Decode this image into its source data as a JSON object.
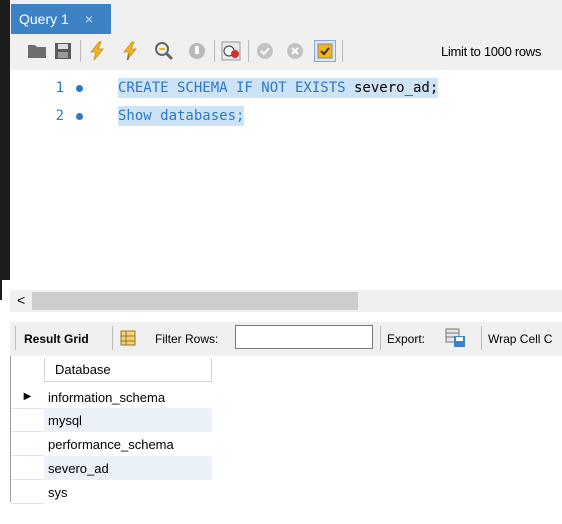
{
  "tab": {
    "label": "Query 1",
    "close": "×"
  },
  "toolbar": {
    "icons": [
      "open-folder-icon",
      "save-icon",
      "execute-icon",
      "execute-current-icon",
      "explain-icon",
      "stop-icon",
      "toggle-error-icon",
      "commit-icon",
      "rollback-icon",
      "autocommit-icon"
    ],
    "limit_label": "Limit to 1000 rows"
  },
  "editor": {
    "lines": [
      {
        "number": "1",
        "keywords": "CREATE SCHEMA IF NOT EXISTS",
        "rest": " severo_ad;"
      },
      {
        "number": "2",
        "keywords": "Show databases;",
        "rest": ""
      }
    ]
  },
  "scroll": {
    "left_arrow": "<"
  },
  "result_toolbar": {
    "result_grid": "Result Grid",
    "filter_rows": "Filter Rows:",
    "filter_value": "",
    "export": "Export:",
    "wrap": "Wrap Cell C"
  },
  "grid": {
    "header": "Database",
    "rows": [
      "information_schema",
      "mysql",
      "performance_schema",
      "severo_ad",
      "sys"
    ],
    "current_row_marker": "▶"
  },
  "colors": {
    "accent": "#3e82c6",
    "selection": "#cfe3f7",
    "keyword": "#2b78c5",
    "alt_row": "#eaf1f9"
  }
}
